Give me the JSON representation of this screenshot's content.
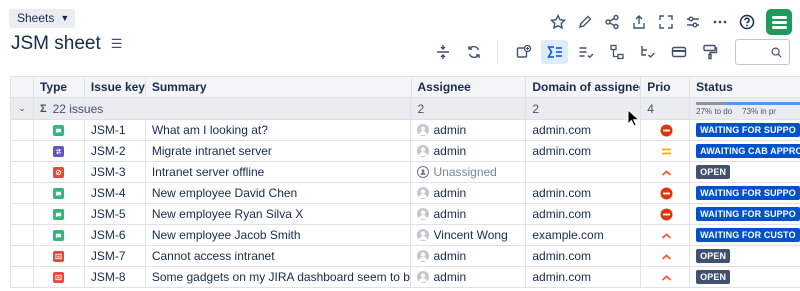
{
  "header": {
    "sheets_label": "Sheets",
    "title": "JSM sheet"
  },
  "top_icons": [
    "star-icon",
    "pencil-icon",
    "share-icon",
    "export-icon",
    "fullscreen-icon",
    "sliders-icon",
    "more-icon",
    "help-icon"
  ],
  "toolbar_icons": [
    "row-height-icon",
    "refresh-icon",
    "add-field-icon",
    "sum-icon",
    "checklist-icon",
    "hierarchy-icon",
    "tree-check-icon",
    "card-icon",
    "paint-format-icon"
  ],
  "search": {
    "placeholder": ""
  },
  "columns": [
    "Type",
    "Issue key",
    "Summary",
    "Assignee",
    "Domain of assignee",
    "Prio",
    "Status"
  ],
  "summary_row": {
    "sigma": "Σ",
    "issues": "22 issues",
    "assignee_count": "2",
    "domain_count": "2",
    "prio_count": "4",
    "status_todo_label": "27% to do",
    "status_inprogress_label": "73% in pr",
    "status_todo_fraction": 0.27,
    "status_inprogress_fraction": 0.73
  },
  "rows": [
    {
      "type": "service-request",
      "type_color": "#36b37e",
      "key": "JSM-1",
      "summary": "What am I looking at?",
      "assignee": "admin",
      "assignee_kind": "user",
      "domain": "admin.com",
      "prio": "highest",
      "status": "WAITING FOR SUPPO",
      "status_style": "blue"
    },
    {
      "type": "change",
      "type_color": "#6554c0",
      "key": "JSM-2",
      "summary": "Migrate intranet server",
      "assignee": "admin",
      "assignee_kind": "user",
      "domain": "admin.com",
      "prio": "medium",
      "status": "AWAITING CAB APPRO",
      "status_style": "blue"
    },
    {
      "type": "incident",
      "type_color": "#e5493a",
      "key": "JSM-3",
      "summary": "Intranet server offline",
      "assignee": "Unassigned",
      "assignee_kind": "unassigned",
      "domain": "",
      "prio": "high",
      "status": "OPEN",
      "status_style": "dark"
    },
    {
      "type": "service-request",
      "type_color": "#36b37e",
      "key": "JSM-4",
      "summary": "New employee David Chen",
      "assignee": "admin",
      "assignee_kind": "user",
      "domain": "admin.com",
      "prio": "highest",
      "status": "WAITING FOR SUPPO",
      "status_style": "blue"
    },
    {
      "type": "service-request",
      "type_color": "#36b37e",
      "key": "JSM-5",
      "summary": "New employee Ryan Silva X",
      "assignee": "admin",
      "assignee_kind": "user",
      "domain": "admin.com",
      "prio": "highest",
      "status": "WAITING FOR SUPPO",
      "status_style": "blue"
    },
    {
      "type": "service-request",
      "type_color": "#36b37e",
      "key": "JSM-6",
      "summary": "New employee Jacob Smith",
      "assignee": "Vincent Wong",
      "assignee_kind": "user",
      "domain": "example.com",
      "prio": "high",
      "status": "WAITING FOR CUSTO",
      "status_style": "blue"
    },
    {
      "type": "problem",
      "type_color": "#e5493a",
      "key": "JSM-7",
      "summary": "Cannot access intranet",
      "assignee": "admin",
      "assignee_kind": "user",
      "domain": "admin.com",
      "prio": "high",
      "status": "OPEN",
      "status_style": "dark"
    },
    {
      "type": "problem",
      "type_color": "#e5493a",
      "key": "JSM-8",
      "summary": "Some gadgets on my JIRA dashboard seem to be bro…",
      "assignee": "admin",
      "assignee_kind": "user",
      "domain": "admin.com",
      "prio": "high",
      "status": "OPEN",
      "status_style": "dark"
    }
  ]
}
